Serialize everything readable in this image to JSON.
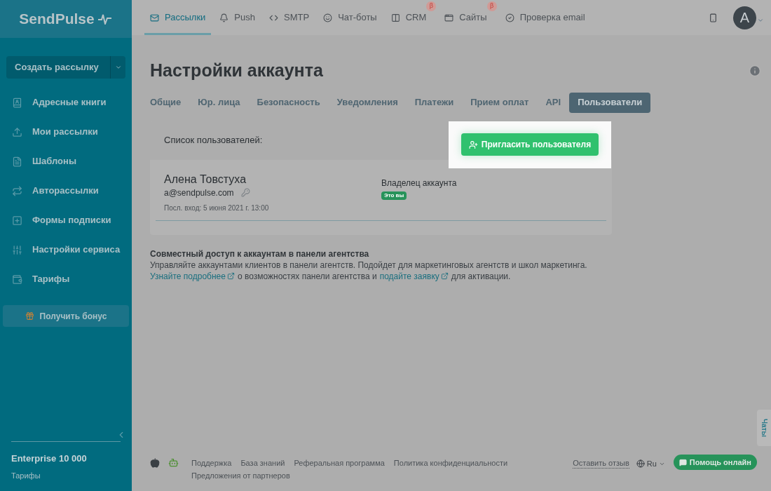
{
  "logo": "SendPulse",
  "top_nav": [
    {
      "label": "Рассылки",
      "selected": true
    },
    {
      "label": "Push",
      "selected": false
    },
    {
      "label": "SMTP",
      "selected": false
    },
    {
      "label": "Чат-боты",
      "selected": false
    },
    {
      "label": "CRM",
      "selected": false,
      "badge": "β"
    },
    {
      "label": "Сайты",
      "selected": false,
      "badge": "β"
    },
    {
      "label": "Проверка email",
      "selected": false
    }
  ],
  "avatar": "A",
  "sidebar": {
    "create_button": "Создать рассылку",
    "items": [
      {
        "label": "Адресные книги"
      },
      {
        "label": "Мои рассылки"
      },
      {
        "label": "Шаблоны"
      },
      {
        "label": "Авторассылки"
      },
      {
        "label": "Формы подписки"
      },
      {
        "label": "Настройки сервиса"
      },
      {
        "label": "Тарифы"
      }
    ],
    "bonus_button": "Получить бонус",
    "plan": "Enterprise 10 000",
    "plan_link": "Тарифы"
  },
  "page_title": "Настройки аккаунта",
  "tabs": [
    {
      "label": "Общие",
      "selected": false
    },
    {
      "label": "Юр. лица",
      "selected": false
    },
    {
      "label": "Безопасность",
      "selected": false
    },
    {
      "label": "Уведомления",
      "selected": false
    },
    {
      "label": "Платежи",
      "selected": false
    },
    {
      "label": "Прием оплат",
      "selected": false
    },
    {
      "label": "API",
      "selected": false
    },
    {
      "label": "Пользователи",
      "selected": true
    }
  ],
  "users_card": {
    "title": "Список пользователей:",
    "invite_button": "Пригласить пользователя",
    "users": [
      {
        "name": "Алена Товстуха",
        "email": "a@sendpulse.com",
        "last_login": "Посл. вход: 5 июня 2021 г. 13:00",
        "role": "Владелец аккаунта",
        "badge": "Это вы"
      }
    ]
  },
  "agency": {
    "title": "Совместный доступ к аккаунтам в панели агентства",
    "text": "Управляйте аккаунтами клиентов в панели агентств. Подойдет для маркетинговых агентств и школ маркетинга.",
    "line": [
      {
        "kind": "link",
        "text": "Узнайте подробнее"
      },
      {
        "kind": "text",
        "text": "о возможностях панели агентства и"
      },
      {
        "kind": "link",
        "text": "подайте заявку"
      },
      {
        "kind": "text",
        "text": "для активации."
      }
    ]
  },
  "footer": {
    "links": [
      "Поддержка",
      "База знаний",
      "Реферальная программа",
      "Политика конфиденциальности",
      "Предложения от партнеров"
    ],
    "feedback": "Оставить отзыв",
    "language": "Ru",
    "help_button": "Помощь онлайн"
  },
  "chats_tab": "Чаты"
}
